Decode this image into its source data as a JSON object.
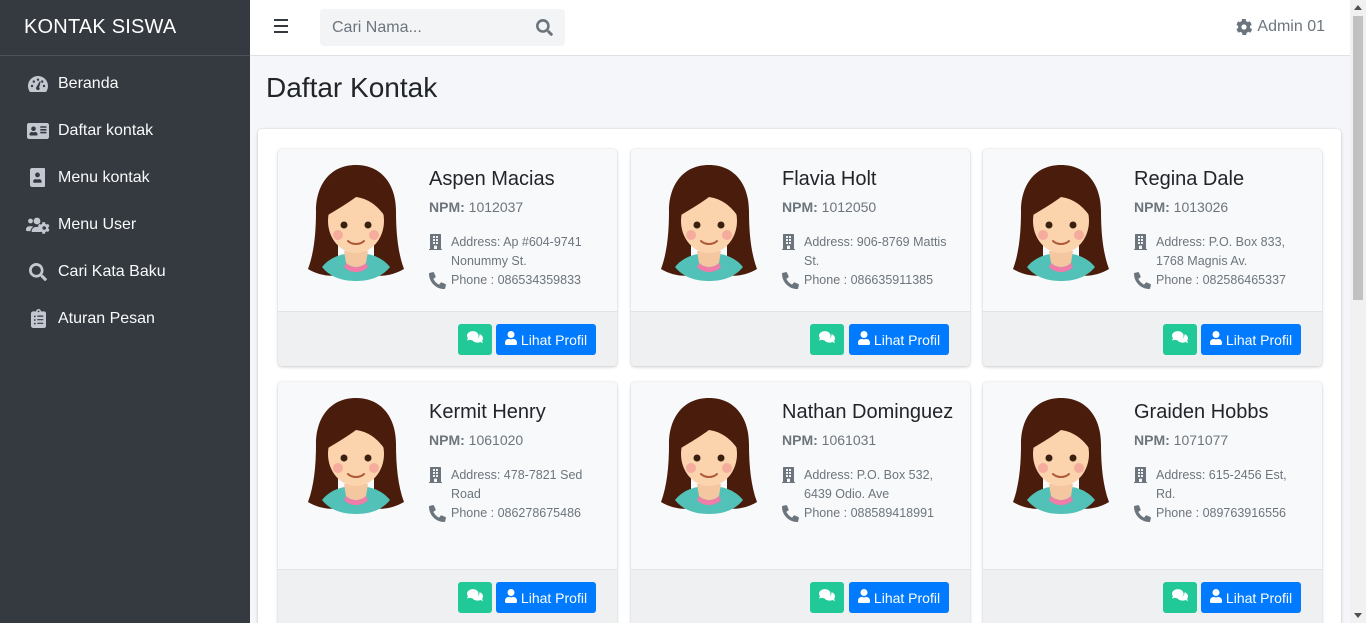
{
  "sidebar": {
    "brand": "KONTAK SISWA",
    "items": [
      {
        "label": "Beranda",
        "icon": "tachometer-icon"
      },
      {
        "label": "Daftar kontak",
        "icon": "address-card-icon"
      },
      {
        "label": "Menu kontak",
        "icon": "address-book-icon"
      },
      {
        "label": "Menu User",
        "icon": "users-cog-icon"
      },
      {
        "label": "Cari Kata Baku",
        "icon": "search-icon"
      },
      {
        "label": "Aturan Pesan",
        "icon": "clipboard-list-icon"
      }
    ]
  },
  "topbar": {
    "search_placeholder": "Cari Nama...",
    "user_label": "Admin 01"
  },
  "page": {
    "title": "Daftar Kontak"
  },
  "labels": {
    "npm": "NPM:",
    "view_profile": "Lihat Profil"
  },
  "contacts": [
    {
      "name": "Aspen Macias",
      "npm": "1012037",
      "address": "Address: Ap #604-9741 Nonummy St.",
      "phone": "Phone : 086534359833"
    },
    {
      "name": "Flavia Holt",
      "npm": "1012050",
      "address": "Address: 906-8769 Mattis St.",
      "phone": "Phone : 086635911385"
    },
    {
      "name": "Regina Dale",
      "npm": "1013026",
      "address": "Address: P.O. Box 833, 1768 Magnis Av.",
      "phone": "Phone : 082586465337"
    },
    {
      "name": "Kermit Henry",
      "npm": "1061020",
      "address": "Address: 478-7821 Sed Road",
      "phone": "Phone : 086278675486"
    },
    {
      "name": "Nathan Dominguez",
      "npm": "1061031",
      "address": "Address: P.O. Box 532, 6439 Odio. Ave",
      "phone": "Phone : 088589418991"
    },
    {
      "name": "Graiden Hobbs",
      "npm": "1071077",
      "address": "Address: 615-2456 Est, Rd.",
      "phone": "Phone : 089763916556"
    }
  ],
  "colors": {
    "sidebar_bg": "#343a40",
    "primary": "#007bff",
    "chat": "#20c997"
  }
}
